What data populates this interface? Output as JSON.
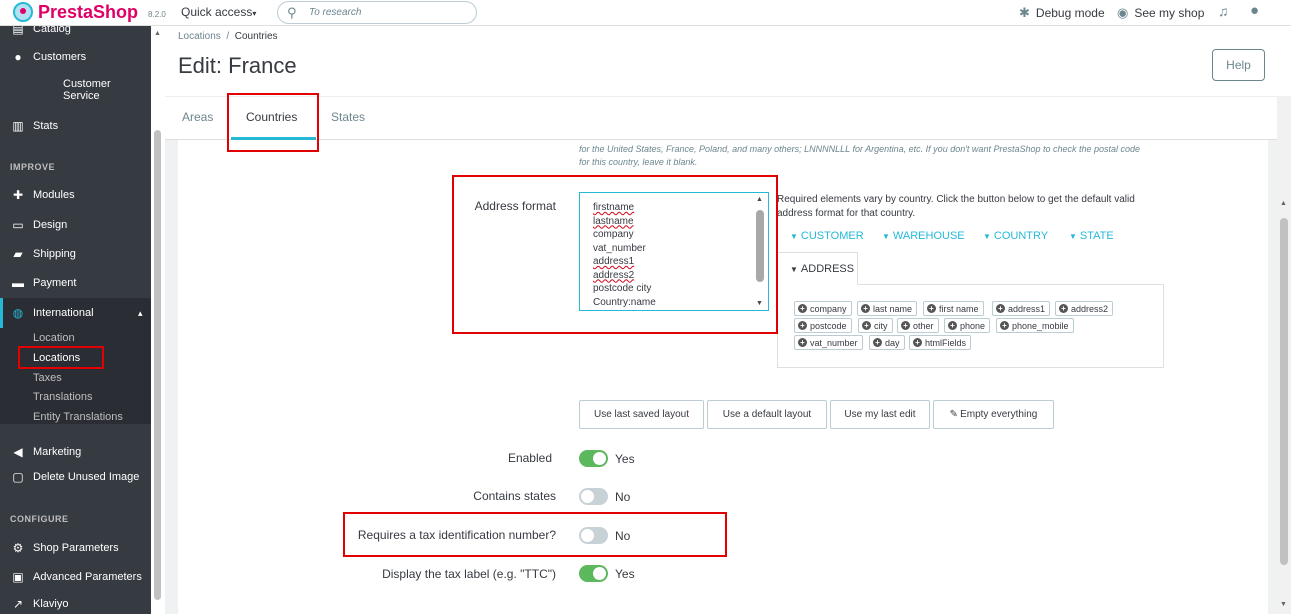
{
  "app": {
    "brand": "PrestaShop",
    "version": "8.2.0"
  },
  "topbar": {
    "quick_access": "Quick access",
    "search_placeholder": "To research",
    "debug_mode": "Debug mode",
    "see_my_shop": "See my shop"
  },
  "sidebar": {
    "catalog": "Catalog",
    "customers": "Customers",
    "customer_service": "Customer Service",
    "stats": "Stats",
    "improve": "IMPROVE",
    "modules": "Modules",
    "design": "Design",
    "shipping": "Shipping",
    "payment": "Payment",
    "international": "International",
    "sub": [
      "Location",
      "Locations",
      "Taxes",
      "Translations",
      "Entity Translations"
    ],
    "marketing": "Marketing",
    "delete_unused": "Delete Unused Image",
    "configure": "CONFIGURE",
    "shop_parameters": "Shop Parameters",
    "advanced_parameters": "Advanced Parameters",
    "klaviyo": "Klaviyo"
  },
  "header": {
    "breadcrumb_parent": "Locations",
    "breadcrumb_sep": "/",
    "breadcrumb_current": "Countries",
    "title": "Edit: France",
    "help": "Help"
  },
  "tabs": [
    "Areas",
    "Countries",
    "States"
  ],
  "form": {
    "postal_help": "for the United States, France, Poland, and many others; LNNNNLLL for Argentina, etc. If you don't want PrestaShop to check the postal code for this country, leave it blank.",
    "address_format_label": "Address format",
    "address_format_lines": [
      "firstname",
      "lastname",
      "company",
      "vat_number",
      "address1",
      "address2",
      "postcode city",
      "Country:name"
    ],
    "required_text": "Required elements vary by country. Click the button below to get the default valid address format for that country.",
    "pattern_tabs": [
      "CUSTOMER",
      "WAREHOUSE",
      "COUNTRY",
      "STATE",
      "ADDRESS"
    ],
    "chips": [
      "company",
      "last name",
      "first name",
      "address1",
      "address2",
      "postcode",
      "city",
      "other",
      "phone",
      "phone_mobile",
      "vat_number",
      "day",
      "htmlFields"
    ],
    "buttons": {
      "last_saved": "Use last saved layout",
      "default": "Use a default layout",
      "last_edit": "Use my last edit",
      "empty": "Empty everything"
    },
    "enabled_label": "Enabled",
    "enabled_value": "Yes",
    "contains_states_label": "Contains states",
    "contains_states_value": "No",
    "tax_id_label": "Requires a tax identification number?",
    "tax_id_value": "No",
    "tax_label_label": "Display the tax label (e.g. \"TTC\")",
    "tax_label_value": "Yes"
  }
}
